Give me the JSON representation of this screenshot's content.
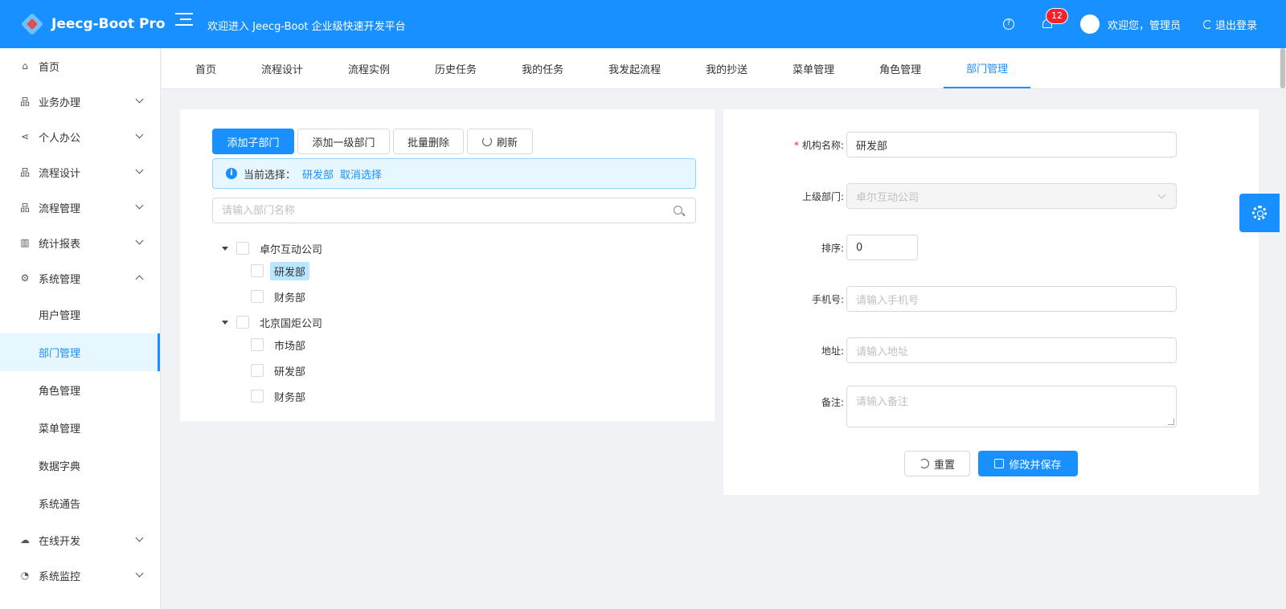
{
  "header": {
    "logo_text": "Jeecg-Boot Pro",
    "welcome": "欢迎进入 Jeecg-Boot 企业级快速开发平台",
    "notification_count": "12",
    "greeting": "欢迎您，管理员",
    "logout_label": "退出登录",
    "help_glyph": "?"
  },
  "sidebar": {
    "home": "首页",
    "items": [
      {
        "label": "业务办理",
        "icon": "org-icon"
      },
      {
        "label": "个人办公",
        "icon": "share-icon"
      },
      {
        "label": "流程设计",
        "icon": "org-icon"
      },
      {
        "label": "流程管理",
        "icon": "org-icon"
      },
      {
        "label": "统计报表",
        "icon": "chart-icon"
      },
      {
        "label": "系统管理",
        "icon": "gear-icon"
      }
    ],
    "sub_items": [
      "用户管理",
      "部门管理",
      "角色管理",
      "菜单管理",
      "数据字典",
      "系统通告"
    ],
    "bottom_items": [
      {
        "label": "在线开发",
        "icon": "cloud-icon"
      },
      {
        "label": "系统监控",
        "icon": "dashboard-icon"
      }
    ]
  },
  "tabs": [
    "首页",
    "流程设计",
    "流程实例",
    "历史任务",
    "我的任务",
    "我发起流程",
    "我的抄送",
    "菜单管理",
    "角色管理",
    "部门管理"
  ],
  "toolbar": {
    "add_child": "添加子部门",
    "add_top": "添加一级部门",
    "batch_delete": "批量删除",
    "refresh": "刷新"
  },
  "selection": {
    "prefix": "当前选择：",
    "current": "研发部",
    "cancel": "取消选择"
  },
  "search": {
    "placeholder": "请输入部门名称"
  },
  "tree": [
    {
      "label": "卓尔互动公司",
      "children": [
        "研发部",
        "财务部"
      ]
    },
    {
      "label": "北京国炬公司",
      "children": [
        "市场部",
        "研发部",
        "财务部"
      ]
    }
  ],
  "form": {
    "name_label": "机构名称:",
    "name_value": "研发部",
    "parent_label": "上级部门:",
    "parent_value": "卓尔互动公司",
    "order_label": "排序:",
    "order_value": "0",
    "phone_label": "手机号:",
    "phone_placeholder": "请输入手机号",
    "address_label": "地址:",
    "address_placeholder": "请输入地址",
    "remark_label": "备注:",
    "remark_placeholder": "请输入备注",
    "reset": "重置",
    "save": "修改并保存"
  },
  "colors": {
    "primary": "#1890ff",
    "badge": "#f5222d",
    "selected_bg": "#bae7ff"
  }
}
